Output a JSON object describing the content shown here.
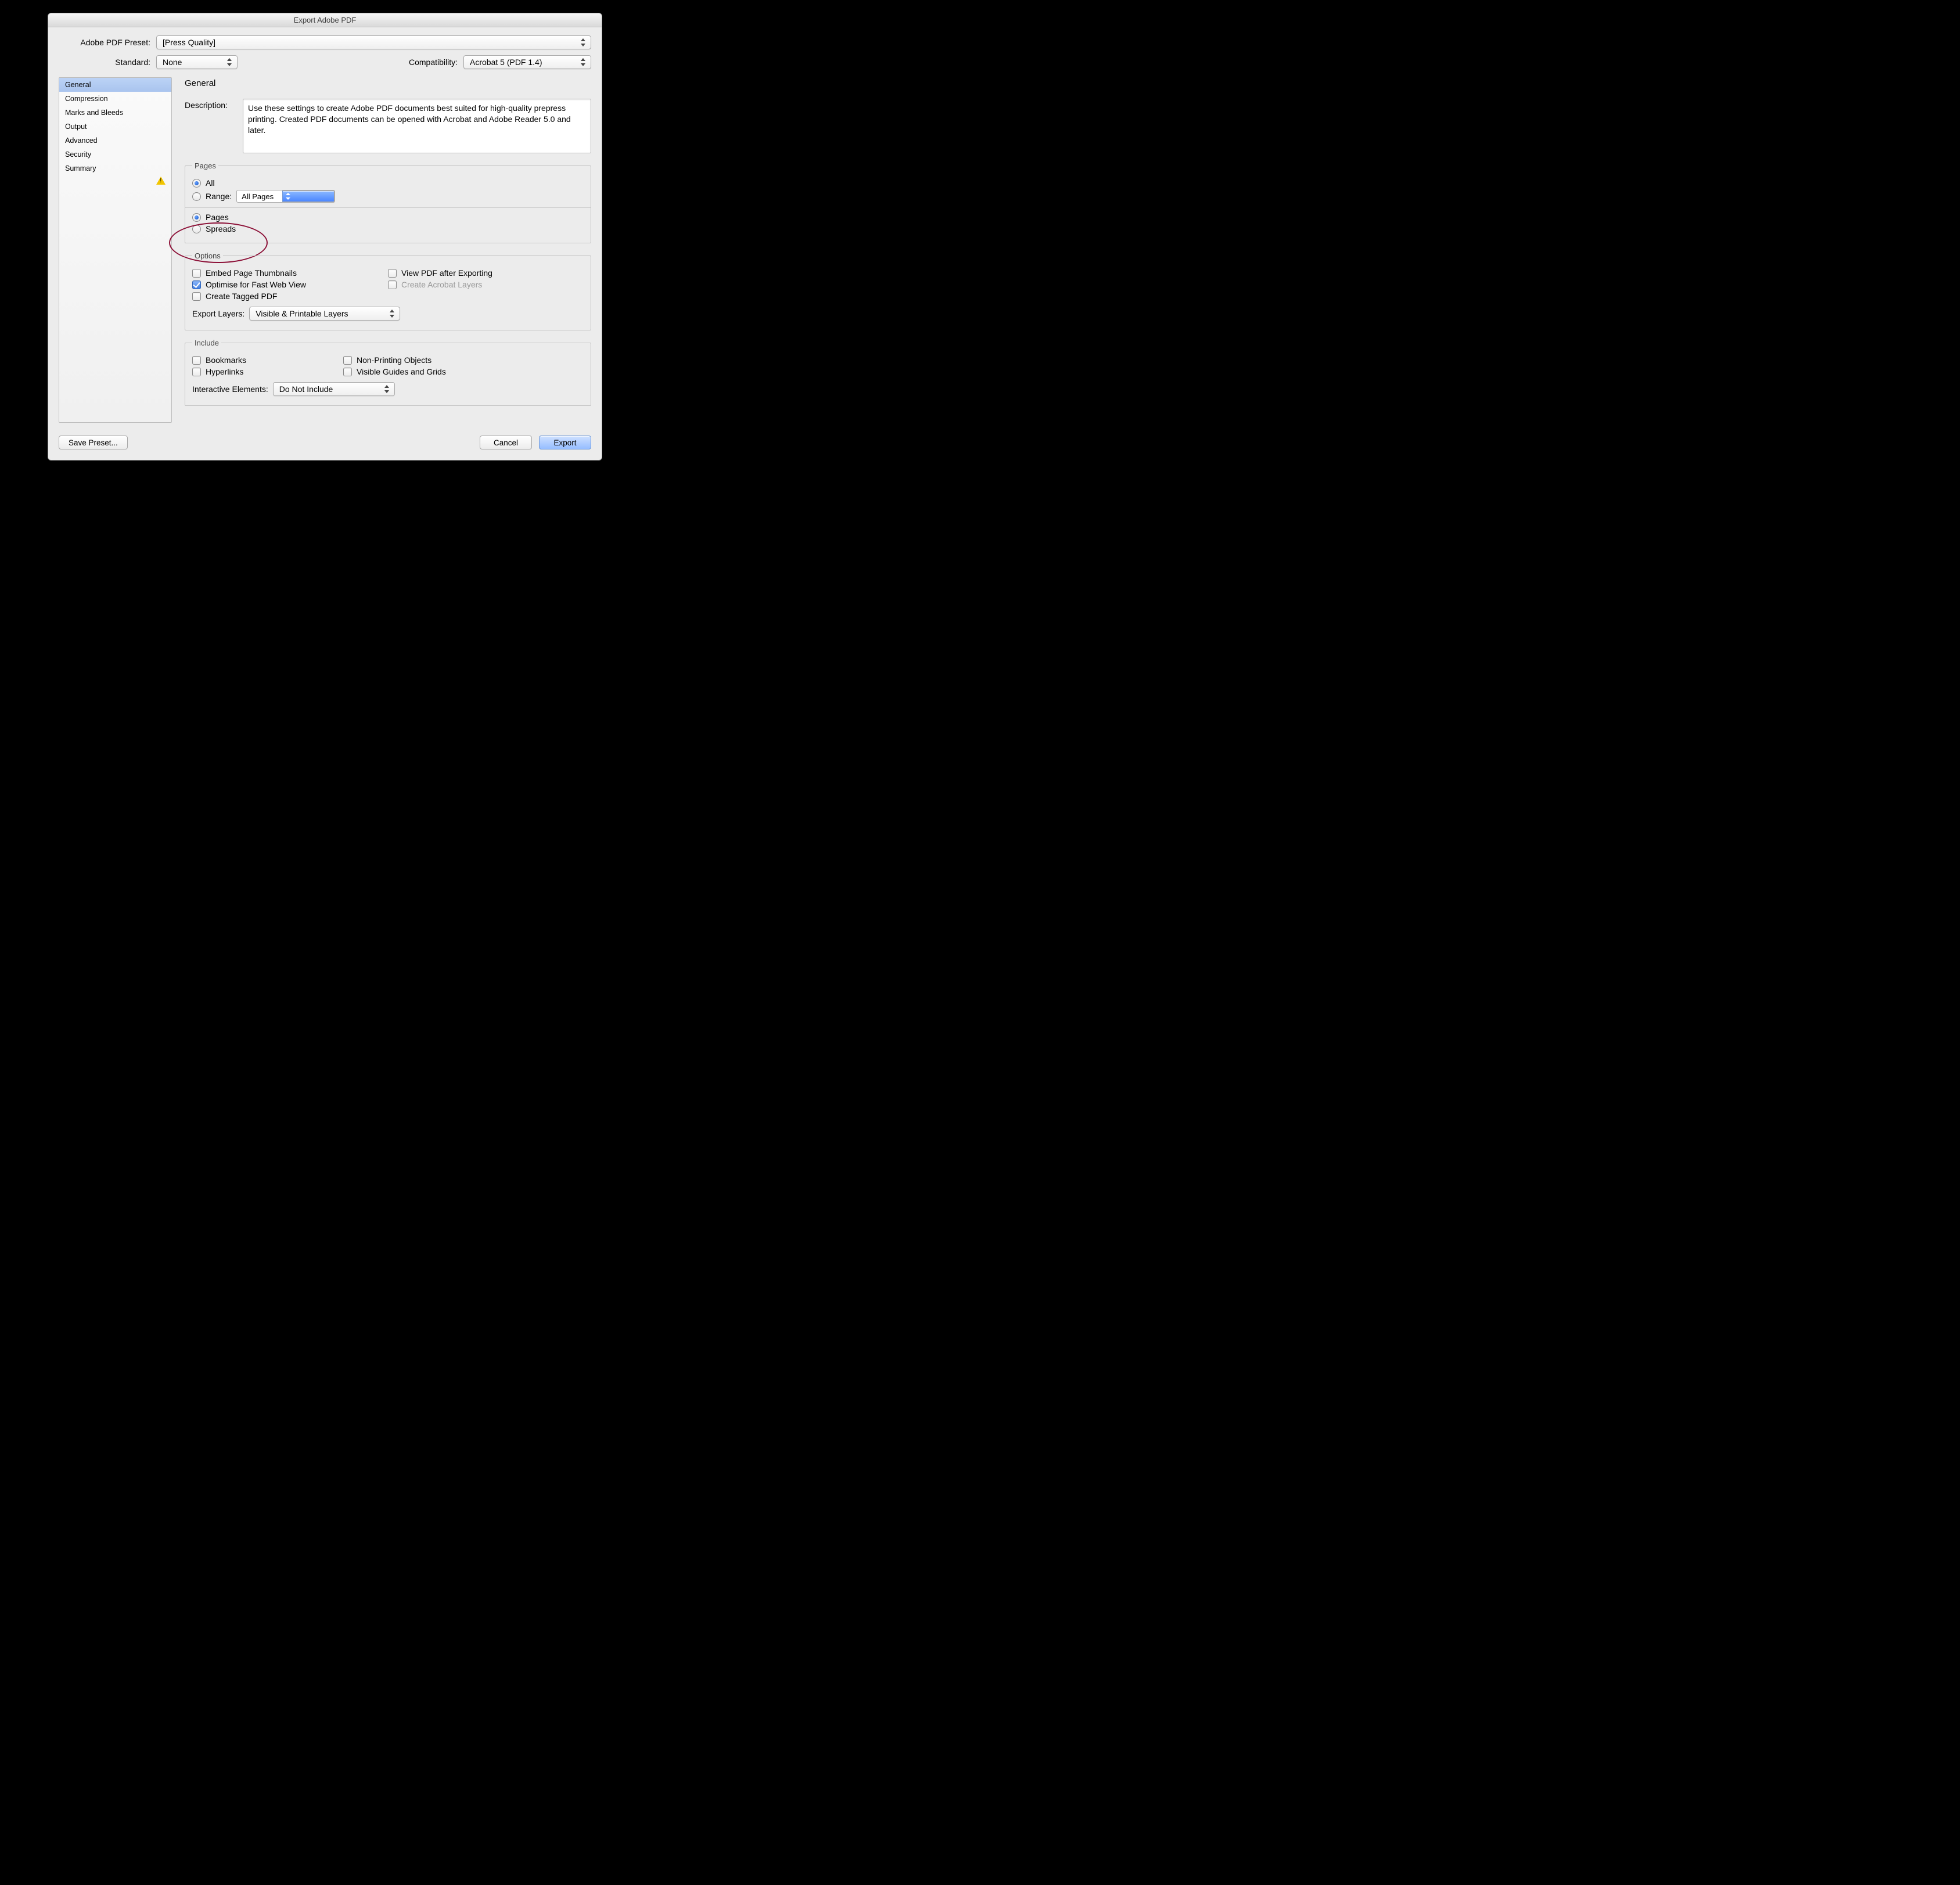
{
  "window_title": "Export Adobe PDF",
  "preset": {
    "label": "Adobe PDF Preset:",
    "value": "[Press Quality]"
  },
  "standard": {
    "label": "Standard:",
    "value": "None"
  },
  "compatibility": {
    "label": "Compatibility:",
    "value": "Acrobat 5 (PDF 1.4)"
  },
  "sidebar": {
    "items": [
      "General",
      "Compression",
      "Marks and Bleeds",
      "Output",
      "Advanced",
      "Security",
      "Summary"
    ],
    "selected": "General"
  },
  "panel_title": "General",
  "description": {
    "label": "Description:",
    "text": "Use these settings to create Adobe PDF documents best suited for high-quality prepress printing.  Created PDF documents can be opened with Acrobat and Adobe Reader 5.0 and later."
  },
  "pages": {
    "legend": "Pages",
    "all": "All",
    "range_label": "Range:",
    "range_value": "All Pages",
    "pages": "Pages",
    "spreads": "Spreads"
  },
  "options": {
    "legend": "Options",
    "embed": "Embed Page Thumbnails",
    "optimise": "Optimise for Fast Web View",
    "tagged": "Create Tagged PDF",
    "view_after": "View PDF after Exporting",
    "layers": "Create Acrobat Layers",
    "export_layers_label": "Export Layers:",
    "export_layers_value": "Visible & Printable Layers"
  },
  "include": {
    "legend": "Include",
    "bookmarks": "Bookmarks",
    "hyperlinks": "Hyperlinks",
    "nonprinting": "Non-Printing Objects",
    "guides": "Visible Guides and Grids",
    "interactive_label": "Interactive Elements:",
    "interactive_value": "Do Not Include"
  },
  "buttons": {
    "save_preset": "Save Preset...",
    "cancel": "Cancel",
    "export": "Export"
  }
}
